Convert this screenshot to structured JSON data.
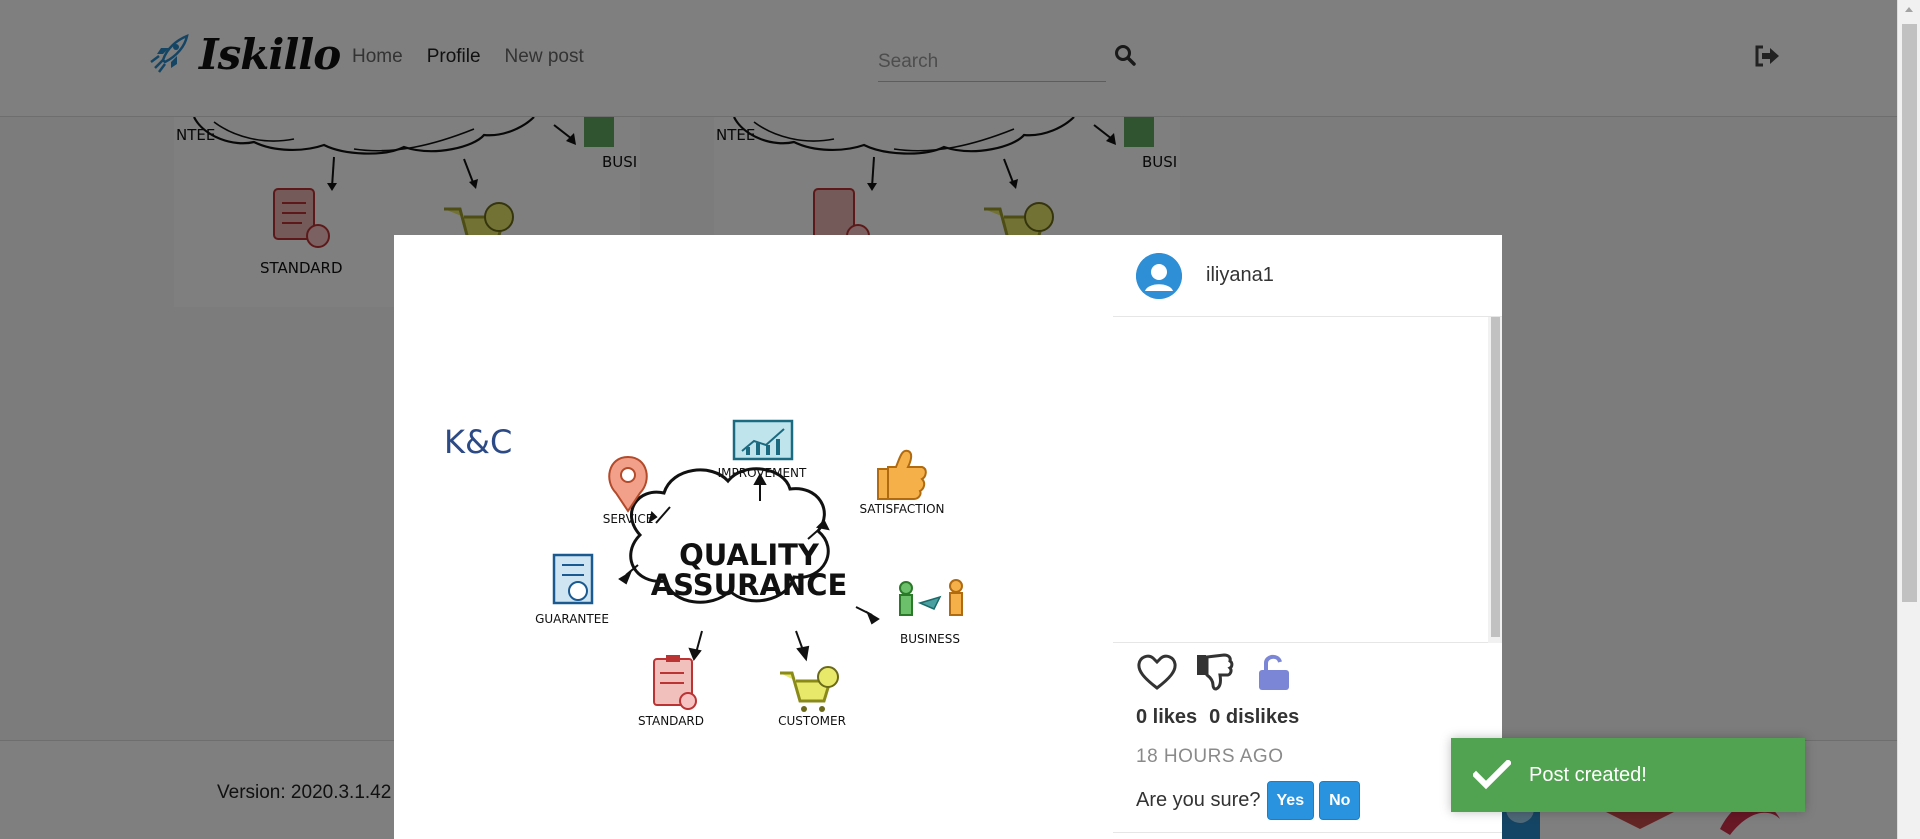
{
  "brand": {
    "name": "Iskillo"
  },
  "nav": {
    "links": [
      {
        "label": "Home"
      },
      {
        "label": "Profile"
      },
      {
        "label": "New post"
      }
    ]
  },
  "search": {
    "placeholder": "Search",
    "value": ""
  },
  "icons": {
    "logo": "rocket-icon",
    "search": "search-icon",
    "logout": "sign-out-icon",
    "like": "heart-outline-icon",
    "dislike": "thumbs-down-icon",
    "visibility": "unlock-icon",
    "toast": "check-icon"
  },
  "background": {
    "version": "Version: 2020.3.1.42"
  },
  "post": {
    "author": "iliyana1",
    "likes": "0 likes",
    "dislikes": "0 dislikes",
    "time": "18 HOURS AGO",
    "confirm_question": "Are you sure?",
    "yes_label": "Yes",
    "no_label": "No",
    "image": {
      "corner_text": "K&C",
      "center_line1": "QUALITY",
      "center_line2": "ASSURANCE",
      "labels": {
        "service": "SERVICE",
        "improvement": "IMPROVEMENT",
        "satisfaction": "SATISFACTION",
        "guarantee": "GUARANTEE",
        "business": "BUSINESS",
        "standard": "STANDARD",
        "customer": "CUSTOMER"
      }
    }
  },
  "bg_cards": {
    "left_labels": [
      "NTEE",
      "BUSI",
      "STANDARD"
    ],
    "right_labels": [
      "NTEE",
      "BUSI"
    ]
  },
  "toast": {
    "message": "Post created!"
  },
  "colors": {
    "accent": "#2a93df",
    "toast_bg": "#51a351",
    "avatar": "#2e8fd6",
    "lock": "#7b86d6"
  }
}
